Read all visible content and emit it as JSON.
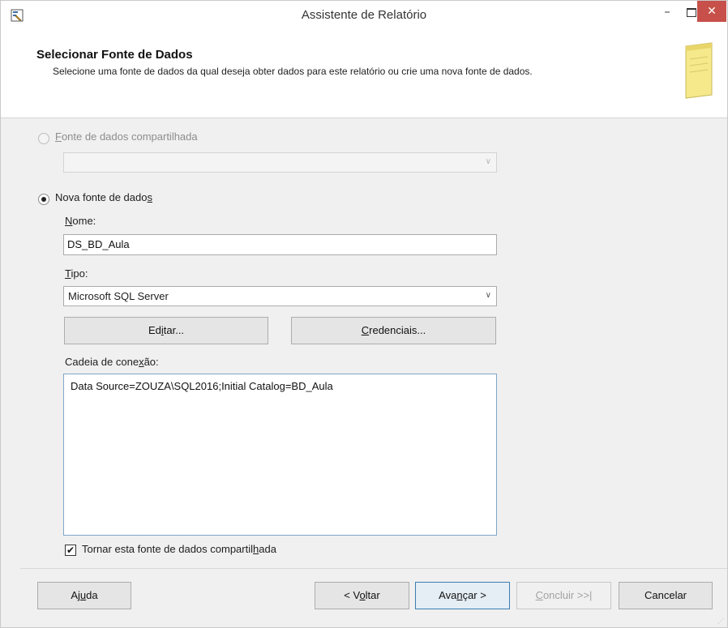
{
  "window": {
    "title": "Assistente de Relatório",
    "minimize_glyph": "–",
    "close_glyph": "✕",
    "app_icon": "report-wizard-icon"
  },
  "header": {
    "title": "Selecionar Fonte de Dados",
    "description": "Selecione uma fonte de dados da qual deseja obter dados para este relatório ou crie uma nova fonte de dados.",
    "icon": "notepad-icon"
  },
  "shared_source": {
    "label_access": "F",
    "label_rest": "onte de dados compartilhada",
    "selected": false,
    "enabled": false,
    "combo_value": ""
  },
  "new_source": {
    "label_main": "Nova fonte de dado",
    "label_access": "s",
    "selected": true,
    "name_label_access": "N",
    "name_label_rest": "ome:",
    "name_value": "DS_BD_Aula",
    "type_label_access": "T",
    "type_label_rest": "ipo:",
    "type_value": "Microsoft SQL Server",
    "edit_button": {
      "pre": "Ed",
      "access": "i",
      "post": "tar..."
    },
    "credentials_button": {
      "pre": "",
      "access": "C",
      "post": "redenciais..."
    },
    "connection_label": {
      "pre": "Cadeia de cone",
      "access": "x",
      "post": "ão:"
    },
    "connection_string": "Data Source=ZOUZA\\SQL2016;Initial Catalog=BD_Aula",
    "share_checkbox": {
      "checked": true,
      "pre": "Tornar esta fonte de dados compartil",
      "access": "h",
      "post": "ada"
    }
  },
  "footer": {
    "help": {
      "pre": "Aj",
      "access": "u",
      "post": "da"
    },
    "back": {
      "pre": "< V",
      "access": "o",
      "post": "ltar"
    },
    "next": {
      "pre": "Ava",
      "access": "n",
      "post": "çar >"
    },
    "finish": {
      "pre": "",
      "access": "C",
      "post": "oncluir >>|"
    },
    "cancel": "Cancelar"
  },
  "colors": {
    "close_button": "#c7504a",
    "primary_border": "#3c7fb1",
    "dialog_bg": "#f0f0f0"
  }
}
